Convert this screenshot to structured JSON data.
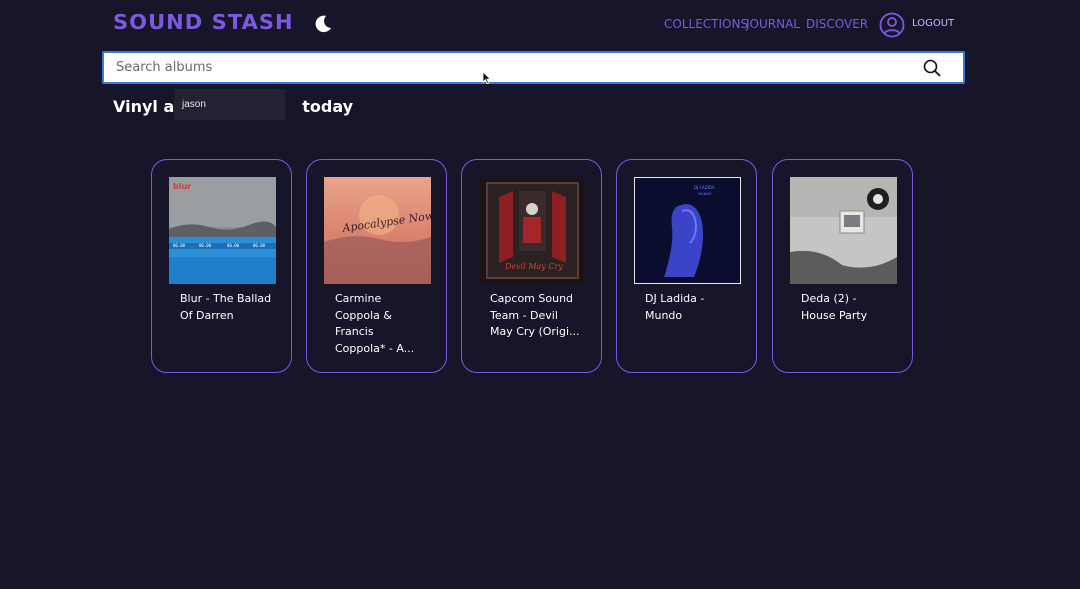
{
  "header": {
    "logo": "SOUND STASH",
    "nav": [
      "COLLECTIONS",
      "JOURNAL",
      "DISCOVER"
    ],
    "logout": "LOGOUT"
  },
  "search": {
    "placeholder": "Search albums",
    "value": "",
    "suggestion": "jason"
  },
  "heading": {
    "left": "Vinyl all",
    "right": "today"
  },
  "albums": [
    {
      "title": "Blur - The Ballad Of Darren"
    },
    {
      "title": "Carmine Coppola & Francis Coppola* - A..."
    },
    {
      "title": "Capcom Sound Team - Devil May Cry (Origi..."
    },
    {
      "title": "DJ Ladida - Mundo"
    },
    {
      "title": "Deda (2) - House Party"
    }
  ],
  "colors": {
    "background": "#16152a",
    "accent": "#7b5ae0",
    "search_border": "#3b7bd8"
  },
  "icons": {
    "theme": "moon-icon",
    "account": "user-circle-icon",
    "search": "search-icon"
  }
}
